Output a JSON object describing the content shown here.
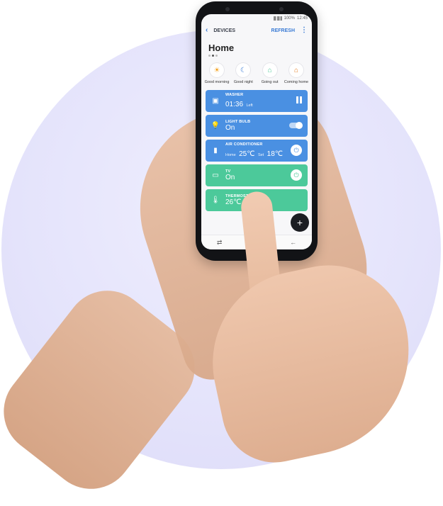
{
  "statusbar": {
    "battery": "100%",
    "time": "12:45"
  },
  "appbar": {
    "back_icon": "chevron-left-icon",
    "title": "DEVICES",
    "refresh_label": "REFRESH",
    "more_icon": "more-vertical-icon"
  },
  "page": {
    "title": "Home"
  },
  "modes": [
    {
      "label": "Good morning",
      "icon": "sun-icon"
    },
    {
      "label": "Good night",
      "icon": "moon-icon"
    },
    {
      "label": "Going out",
      "icon": "house-out-icon"
    },
    {
      "label": "Coming home",
      "icon": "house-in-icon"
    }
  ],
  "devices": {
    "washer": {
      "name": "WASHER",
      "value": "01:36",
      "suffix": "Left",
      "action_icon": "pause-icon"
    },
    "light": {
      "name": "LIGHT BULB",
      "value": "On",
      "action_icon": "toggle-switch"
    },
    "ac": {
      "name": "AIR CONDITIONER",
      "home_label": "Home",
      "home_value": "25℃",
      "set_label": "Set",
      "set_value": "18℃",
      "action_icon": "power-icon"
    },
    "tv": {
      "name": "TV",
      "value": "On",
      "action_icon": "power-icon"
    },
    "thermostat": {
      "name": "THERMOSTAT",
      "value": "26℃"
    }
  },
  "fab": {
    "icon": "plus-icon"
  },
  "colors": {
    "blue_card": "#4a90e2",
    "green_card": "#4cc99a",
    "accent": "#3a7bd5",
    "background_circle": "#e4e3fb"
  }
}
